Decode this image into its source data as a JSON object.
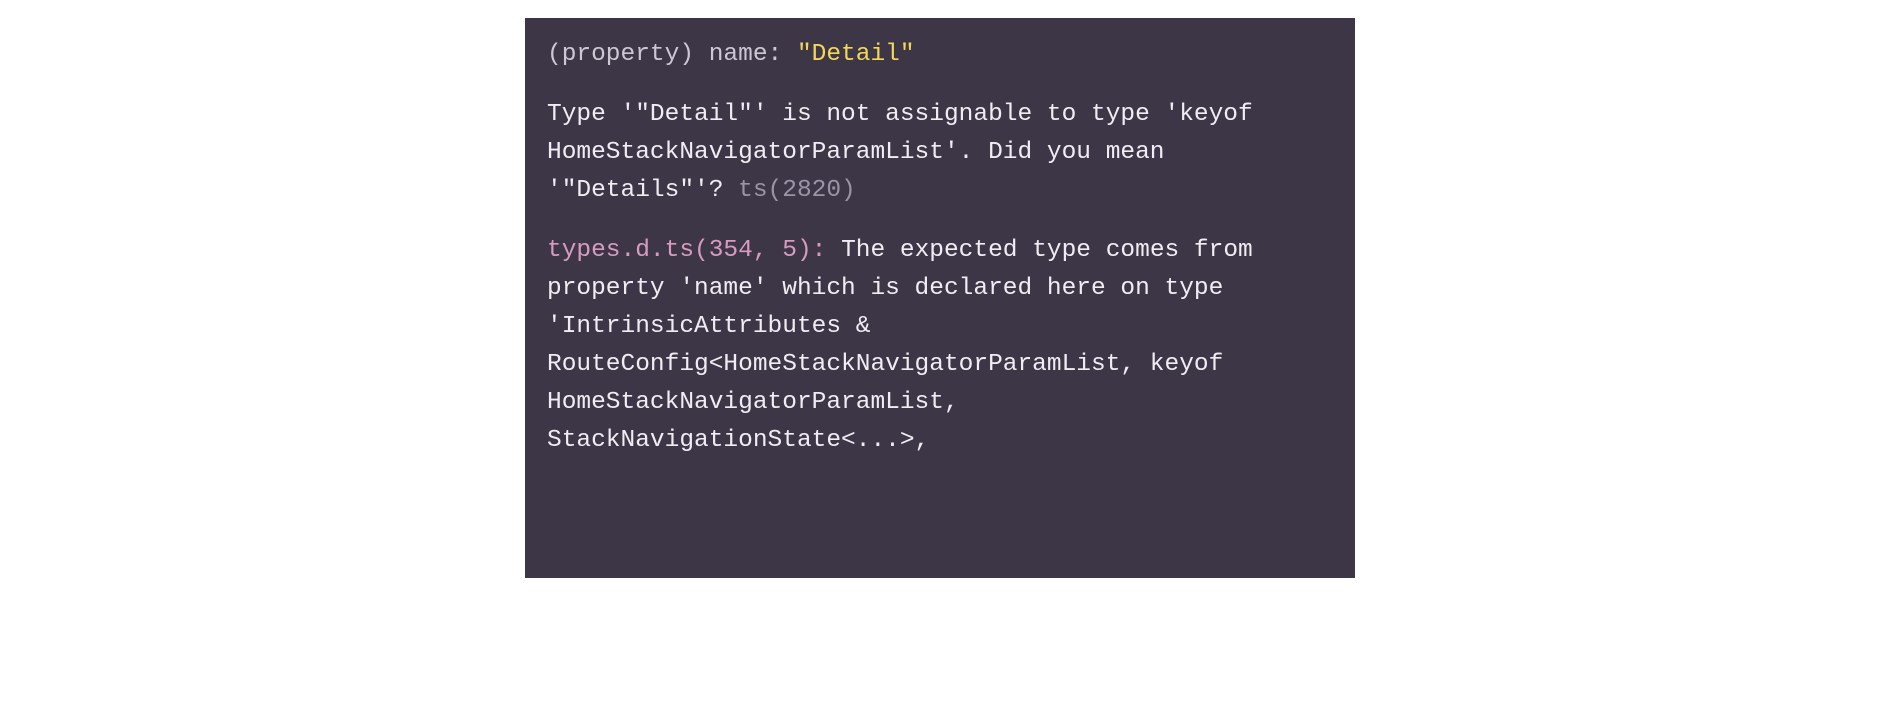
{
  "hover": {
    "signature": {
      "prefix": "(property) name: ",
      "value": "\"Detail\""
    },
    "error": {
      "message": "Type '\"Detail\"' is not assignable to type 'keyof HomeStackNavigatorParamList'. Did you mean '\"Details\"'? ",
      "code": "ts(2820)"
    },
    "related": {
      "source": "types.d.ts(354, 5): ",
      "message": "The expected type comes from property 'name' which is declared here on type 'IntrinsicAttributes & RouteConfig<HomeStackNavigatorParamList, keyof HomeStackNavigatorParamList, StackNavigationState<...>,"
    }
  }
}
